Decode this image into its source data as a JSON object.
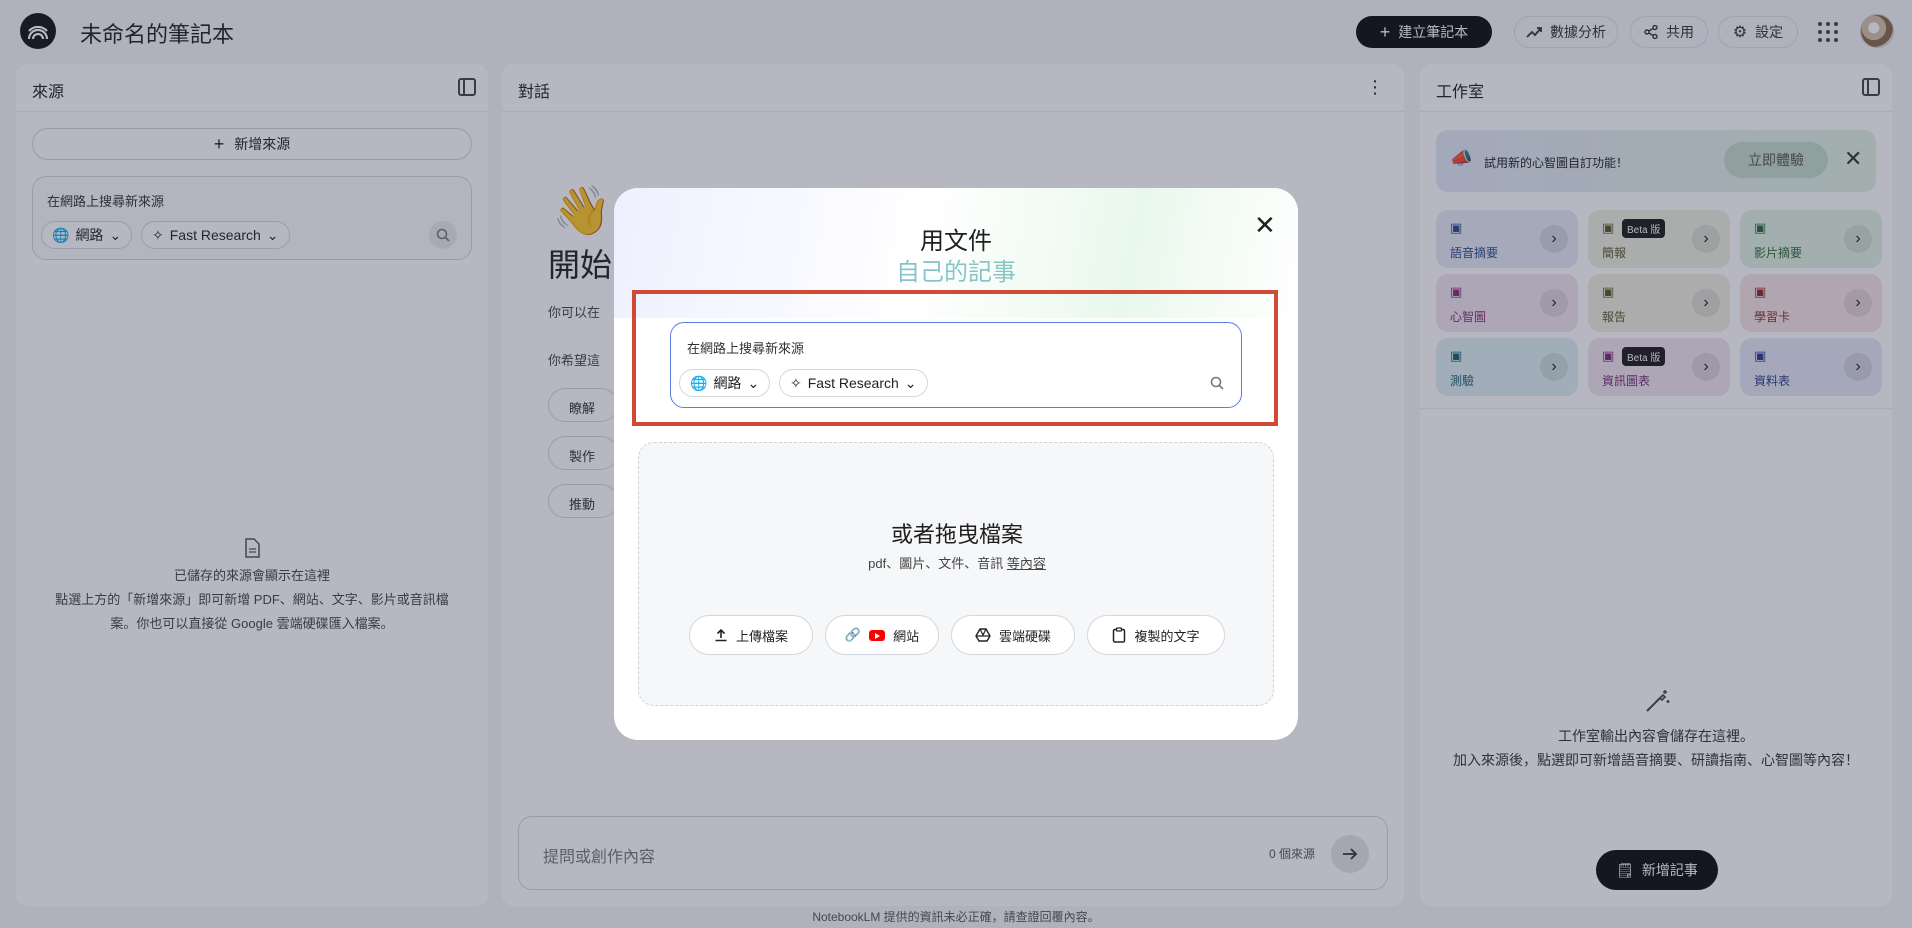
{
  "header": {
    "title": "未命名的筆記本",
    "create_label": "建立筆記本",
    "analytics_label": "數據分析",
    "share_label": "共用",
    "settings_label": "設定"
  },
  "sources": {
    "title": "來源",
    "add_label": "新增來源",
    "search_placeholder": "在網路上搜尋新來源",
    "web_chip": "網路",
    "research_chip": "Fast Research",
    "empty_title": "已儲存的來源會顯示在這裡",
    "empty_line2": "點選上方的「新增來源」即可新增 PDF、網站、文字、影片或音訊檔",
    "empty_line3": "案。你也可以直接從 Google 雲端硬碟匯入檔案。"
  },
  "chat": {
    "title": "對話",
    "heading_partial": "開始",
    "line1_partial": "你可以在",
    "line2_partial": "你希望這",
    "sugg1": "瞭解",
    "sugg2": "製作",
    "sugg3": "推動",
    "input_placeholder": "提問或創作內容",
    "source_count": "0 個來源"
  },
  "studio": {
    "title": "工作室",
    "banner_text": "試用新的心智圖自訂功能！",
    "banner_try": "立即體驗",
    "tiles": [
      {
        "label": "語音摘要",
        "color": "#e6eaf6",
        "text": "#2b4a8c"
      },
      {
        "label": "簡報",
        "color": "#eef0e2",
        "text": "#5a5a2b",
        "beta": "Beta 版"
      },
      {
        "label": "影片摘要",
        "color": "#e3f2e6",
        "text": "#2d6a3a"
      },
      {
        "label": "心智圖",
        "color": "#f1e5f0",
        "text": "#8a2b7c"
      },
      {
        "label": "報告",
        "color": "#f0efe2",
        "text": "#5c5a2b"
      },
      {
        "label": "學習卡",
        "color": "#f7e5e5",
        "text": "#8f2b2b"
      },
      {
        "label": "測驗",
        "color": "#dff0f4",
        "text": "#1f5f70"
      },
      {
        "label": "資訊圖表",
        "color": "#f0e6f1",
        "text": "#7a2b7a",
        "beta": "Beta 版"
      },
      {
        "label": "資料表",
        "color": "#e5e8f6",
        "text": "#2b3a8c"
      }
    ],
    "empty_line1": "工作室輸出內容會儲存在這裡。",
    "empty_line2": "加入來源後，點選即可新增語音摘要、研讀指南、心智圖等內容！",
    "new_note_label": "新增記事"
  },
  "modal": {
    "title_line1": "用文件",
    "title_line2": "自己的記事",
    "search_placeholder": "在網路上搜尋新來源",
    "web_chip": "網路",
    "research_chip": "Fast Research",
    "drop_title": "或者拖曳檔案",
    "drop_formats": "pdf、圖片、文件、音訊",
    "drop_more_link": "等內容",
    "upload_label": "上傳檔案",
    "website_label": "網站",
    "drive_label": "雲端硬碟",
    "paste_label": "複製的文字"
  },
  "footer": {
    "disclaimer": "NotebookLM 提供的資訊未必正確，請查證回覆內容。"
  }
}
